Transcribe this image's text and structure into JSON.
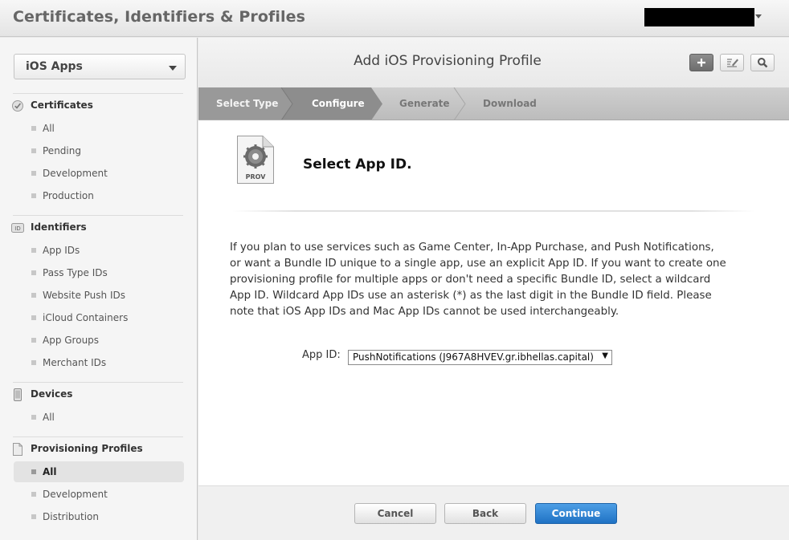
{
  "app": {
    "title": "Certificates, Identifiers & Profiles"
  },
  "sidebar": {
    "platform": "iOS Apps",
    "sections": {
      "certificates": {
        "title": "Certificates",
        "items": [
          "All",
          "Pending",
          "Development",
          "Production"
        ]
      },
      "identifiers": {
        "title": "Identifiers",
        "icon_text": "ID",
        "items": [
          "App IDs",
          "Pass Type IDs",
          "Website Push IDs",
          "iCloud Containers",
          "App Groups",
          "Merchant IDs"
        ]
      },
      "devices": {
        "title": "Devices",
        "items": [
          "All"
        ]
      },
      "profiles": {
        "title": "Provisioning Profiles",
        "items": [
          "All",
          "Development",
          "Distribution"
        ],
        "active": "All"
      }
    }
  },
  "main": {
    "title": "Add iOS Provisioning Profile",
    "steps": [
      "Select Type",
      "Configure",
      "Generate",
      "Download"
    ],
    "icon_text": "PROV",
    "section_title": "Select App ID.",
    "description": "If you plan to use services such as Game Center, In-App Purchase, and Push Notifications, or want a Bundle ID unique to a single app, use an explicit App ID. If you want to create one provisioning profile for multiple apps or don't need a specific Bundle ID, select a wildcard App ID. Wildcard App IDs use an asterisk (*) as the last digit in the Bundle ID field. Please note that iOS App IDs and Mac App IDs cannot be used interchangeably.",
    "app_id_label": "App ID:",
    "app_id_value": "PushNotifications (J967A8HVEV.gr.ibhellas.capital)",
    "app_id_arrow": "▼"
  },
  "footer": {
    "cancel": "Cancel",
    "back": "Back",
    "continue": "Continue"
  },
  "colors": {
    "primary": "#2a7fd4",
    "active_step": "#8f8f8f",
    "inactive_step": "#c6c6c6"
  }
}
